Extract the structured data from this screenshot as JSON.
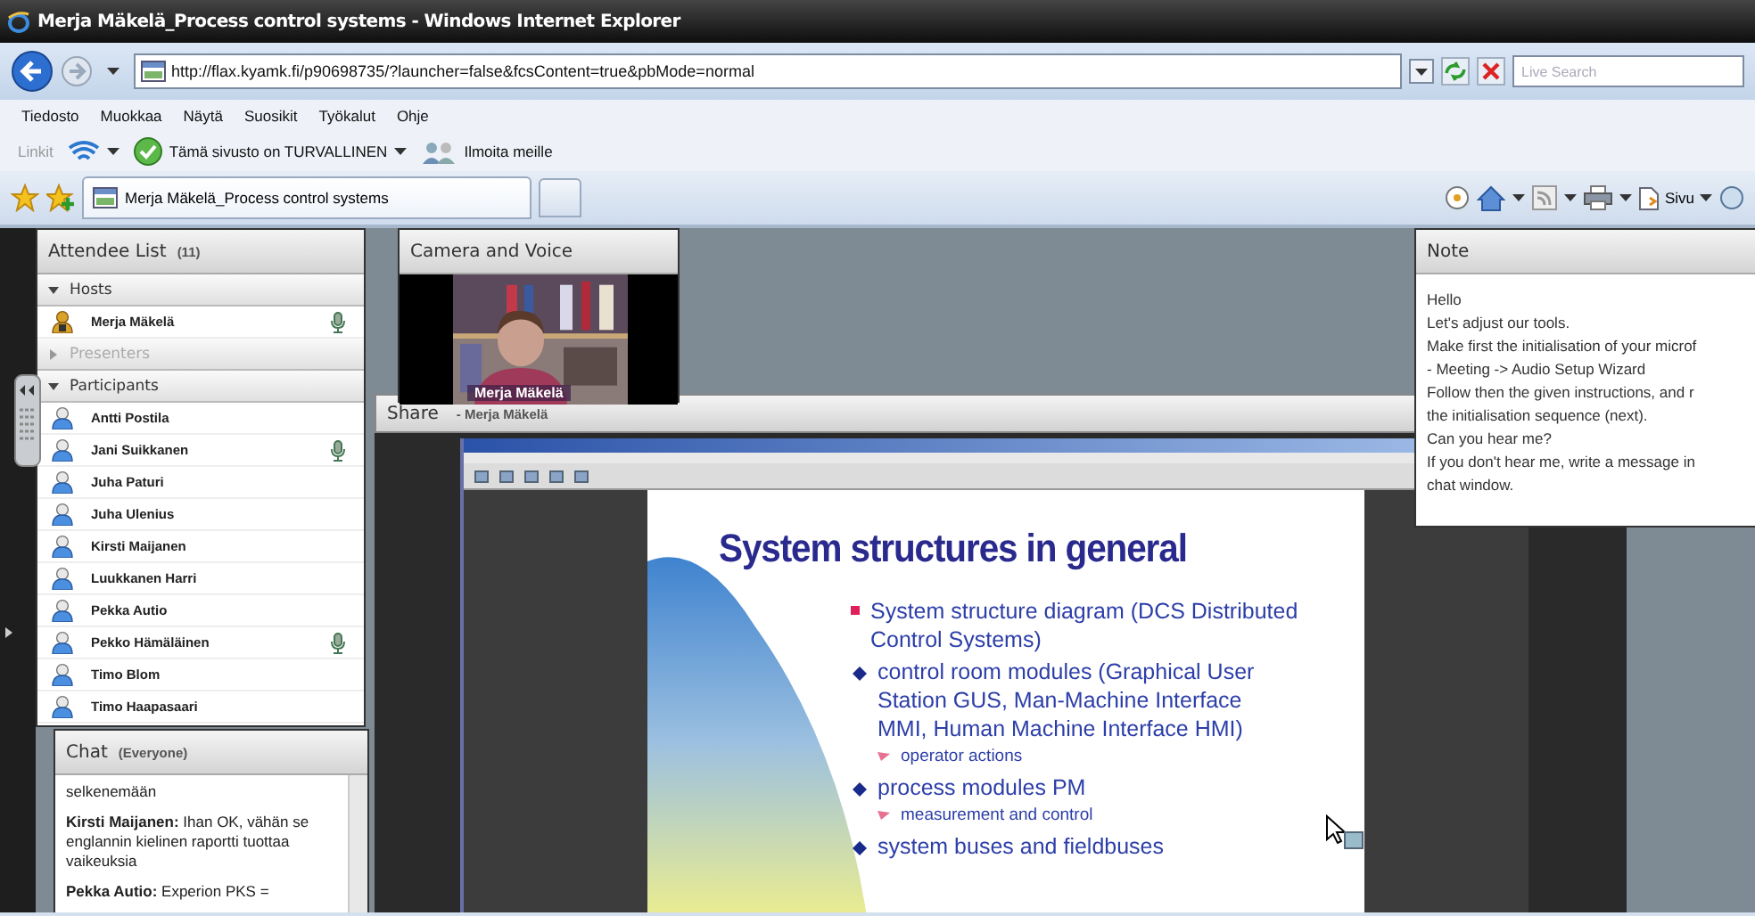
{
  "browser": {
    "title": "Merja Mäkelä_Process control systems - Windows Internet Explorer",
    "address": "http://flax.kyamk.fi/p90698735/?launcher=false&fcsContent=true&pbMode=normal",
    "search": {
      "placeholder": "Live Search"
    },
    "menu": [
      "Tiedosto",
      "Muokkaa",
      "Näytä",
      "Suosikit",
      "Työkalut",
      "Ohje"
    ],
    "links": {
      "label": "Linkit",
      "items": [
        {
          "kind": "feed"
        },
        {
          "kind": "secure",
          "label": "Tämä sivusto on TURVALLINEN"
        },
        {
          "kind": "report",
          "label": "Ilmoita meille"
        }
      ]
    },
    "tabs": [
      {
        "label": "Merja Mäkelä_Process control systems",
        "selected": true
      }
    ],
    "page_menu": "Sivu"
  },
  "attendees": {
    "title": "Attendee List",
    "count": "(11)",
    "groups": [
      {
        "label": "Hosts",
        "expanded": true,
        "disabled": false,
        "people": [
          {
            "name": "Merja Mäkelä",
            "kind": "host",
            "mic": true
          }
        ]
      },
      {
        "label": "Presenters",
        "expanded": false,
        "disabled": true
      },
      {
        "label": "Participants",
        "expanded": true,
        "disabled": false,
        "people": [
          {
            "name": "Antti Postila",
            "kind": "participant",
            "mic": false
          },
          {
            "name": "Jani Suikkanen",
            "kind": "participant",
            "mic": true
          },
          {
            "name": "Juha Paturi",
            "kind": "participant",
            "mic": false
          },
          {
            "name": "Juha Ulenius",
            "kind": "participant",
            "mic": false
          },
          {
            "name": "Kirsti Maijanen",
            "kind": "participant",
            "mic": false
          },
          {
            "name": "Luukkanen Harri",
            "kind": "participant",
            "mic": false
          },
          {
            "name": "Pekka Autio",
            "kind": "participant",
            "mic": false
          },
          {
            "name": "Pekko Hämäläinen",
            "kind": "participant",
            "mic": true
          },
          {
            "name": "Timo Blom",
            "kind": "participant",
            "mic": false
          },
          {
            "name": "Timo Haapasaari",
            "kind": "participant",
            "mic": false
          }
        ]
      }
    ]
  },
  "chat": {
    "title": "Chat",
    "scope": "(Everyone)",
    "messages": [
      "selkenemään",
      "**Kirsti Maijanen:** Ihan OK, vähän se englannin kielinen raportti tuottaa vaikeuksia",
      "**Pekka Autio:** Experion PKS ="
    ]
  },
  "camera": {
    "title": "Camera and Voice",
    "caption": "Merja Mäkelä"
  },
  "share": {
    "title": "Share",
    "presenter": "- Merja Mäkelä",
    "slide": {
      "title": "System structures in general",
      "bullets": [
        {
          "text": "System structure diagram (DCS Distributed Control Systems)",
          "children": [
            {
              "text": "control room modules (Graphical User Station GUS, Man-Machine Interface MMI, Human Machine Interface HMI)",
              "children": [
                {
                  "text": "operator actions"
                }
              ]
            },
            {
              "text": "process modules PM",
              "children": [
                {
                  "text": "measurement and control"
                }
              ]
            },
            {
              "text": "system buses and fieldbuses"
            }
          ]
        }
      ]
    }
  },
  "note": {
    "title": "Note",
    "lines": [
      "Hello",
      "Let's adjust our tools.",
      "Make first the initialisation of your microf",
      "- Meeting  -> Audio Setup Wizard",
      "Follow then the given instructions, and r",
      "the initialisation sequence (next).",
      "Can you hear me?",
      "If you don't hear me, write a message in",
      "chat window."
    ]
  }
}
